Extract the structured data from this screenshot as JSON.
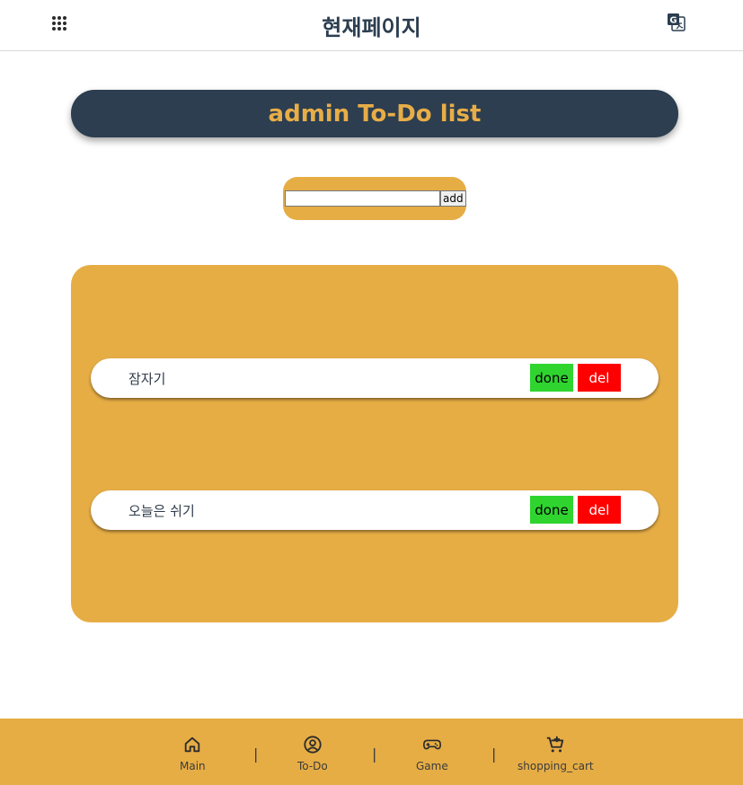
{
  "header": {
    "title": "현재페이지",
    "menu_icon": "grid-menu-icon",
    "translate_icon": "translate-icon"
  },
  "banner": {
    "title": "admin To-Do list"
  },
  "add_form": {
    "input_value": "",
    "placeholder": "",
    "button_label": "add"
  },
  "todos": [
    {
      "text": "잠자기",
      "done_label": "done",
      "del_label": "del"
    },
    {
      "text": "오늘은 쉬기",
      "done_label": "done",
      "del_label": "del"
    }
  ],
  "footer": {
    "items": [
      {
        "label": "Main",
        "icon": "home-icon"
      },
      {
        "label": "To-Do",
        "icon": "user-circle-icon"
      },
      {
        "label": "Game",
        "icon": "gamepad-icon"
      },
      {
        "label": "shopping_cart",
        "icon": "cart-add-icon"
      }
    ],
    "separator": "|"
  },
  "colors": {
    "navy": "#2c3e50",
    "accent": "#e6ad45",
    "done": "#2fd42f",
    "delete": "#ff0000"
  }
}
